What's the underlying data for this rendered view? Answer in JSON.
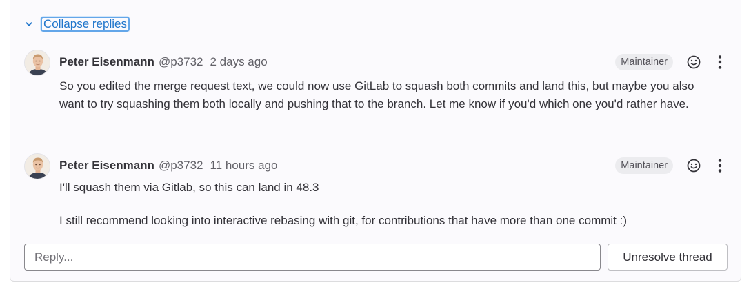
{
  "thread": {
    "collapse_label": "Collapse replies",
    "notes": [
      {
        "author": "Peter Eisenmann",
        "username": "@p3732",
        "time": "2 days ago",
        "role_badge": "Maintainer",
        "body": [
          "So you edited the merge request text, we could now use GitLab to squash both commits and land this, but maybe you also want to try squashing them both locally and pushing that to the branch. Let me know if you'd which one you'd rather have."
        ],
        "icons": [
          "avatar-photo",
          "smiley-icon",
          "kebab-menu-icon"
        ]
      },
      {
        "author": "Peter Eisenmann",
        "username": "@p3732",
        "time": "11 hours ago",
        "role_badge": "Maintainer",
        "body": [
          "I'll squash them via Gitlab, so this can land in 48.3",
          "I still recommend looking into interactive rebasing with git, for contributions that have more than one commit :)"
        ],
        "icons": [
          "avatar-photo",
          "smiley-icon",
          "kebab-menu-icon"
        ]
      }
    ],
    "reply": {
      "placeholder": "Reply...",
      "value": ""
    },
    "unresolve_label": "Unresolve thread"
  },
  "colors": {
    "link": "#1f75cb",
    "focus_ring": "#63a6e9",
    "thread_bg": "#fbfafd",
    "text": "#333238",
    "muted": "#626168",
    "badge_bg": "#ececef"
  }
}
